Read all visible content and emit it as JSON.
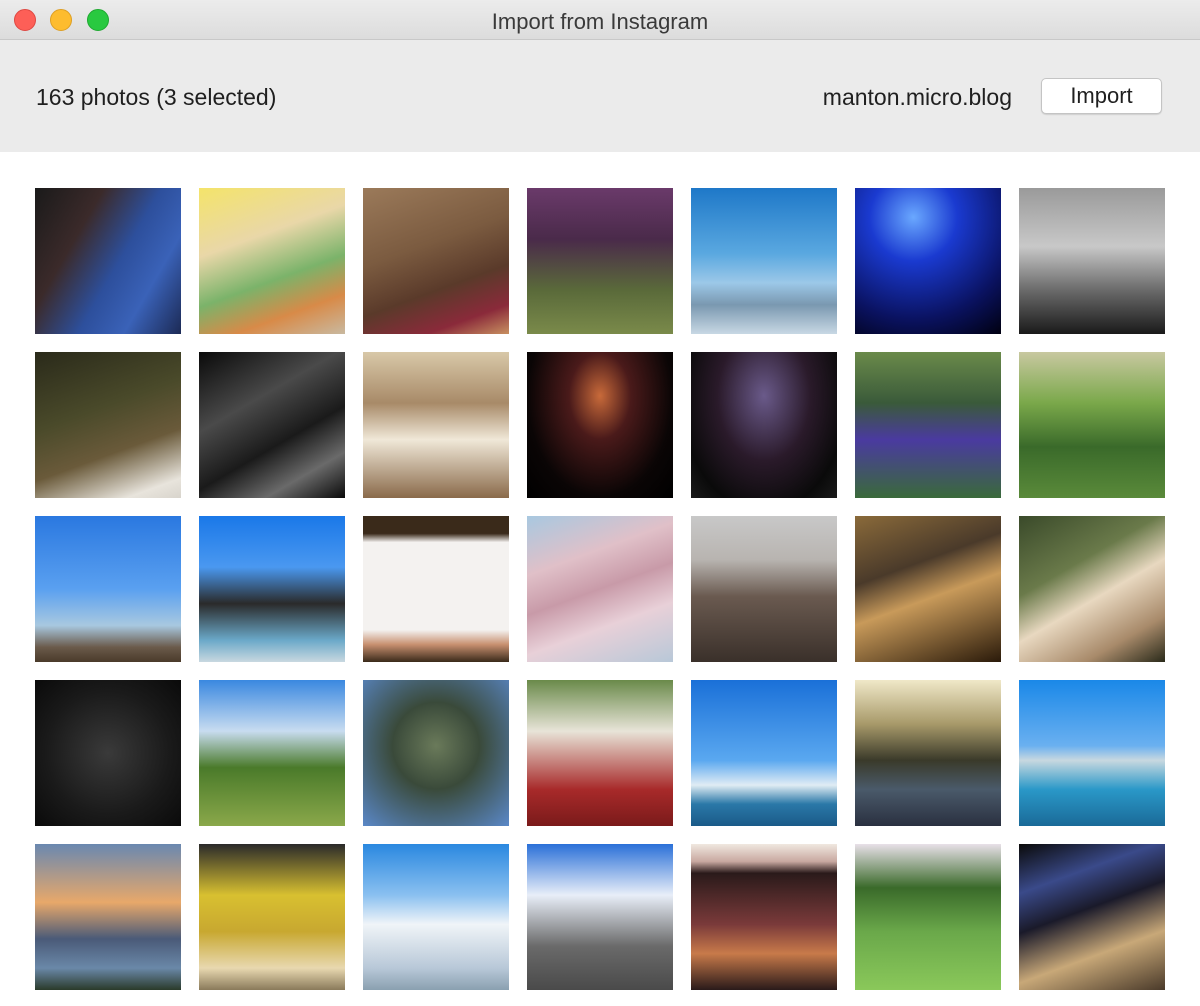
{
  "window": {
    "title": "Import from Instagram"
  },
  "toolbar": {
    "count_text": "163 photos (3 selected)",
    "account": "manton.micro.blog",
    "import_label": "Import"
  },
  "photos": [
    {
      "desc": "warriors-finals-shirt",
      "bg": "linear-gradient(120deg,#1a1a1a 0%,#3b2a2a 30%,#2d4f9c 55%,#3a62b8 75%,#1c2a55 100%)"
    },
    {
      "desc": "juice-bar",
      "bg": "linear-gradient(160deg,#f4e46a 0%,#e9d7a8 35%,#7bb36a 60%,#d88a48 80%,#c9b9a0 100%)"
    },
    {
      "desc": "chipotle-bag",
      "bg": "linear-gradient(160deg,#9b7a5a 0%,#7b5b40 40%,#5a3a2a 65%,#8a2a3a 85%,#c89060 100%)"
    },
    {
      "desc": "purple-trees",
      "bg": "linear-gradient(180deg,#6a3a6a 0%,#4a2a4a 35%,#5a6a3a 70%,#7a8a4a 100%)"
    },
    {
      "desc": "sky-mountains",
      "bg": "linear-gradient(180deg,#1e78c8 0%,#5aa8e0 45%,#9cc8e8 65%,#7a98b0 80%,#c8d8e4 100%)"
    },
    {
      "desc": "concert-blue",
      "bg": "radial-gradient(circle at 40% 20%,#6aa8ff 0%,#1a3ad0 30%,#0a1260 70%,#000010 100%)"
    },
    {
      "desc": "austin-bw",
      "bg": "linear-gradient(180deg,#9a9a9a 0%,#c8c8c8 40%,#6a6a6a 70%,#1a1a1a 100%)"
    },
    {
      "desc": "dog-trail",
      "bg": "linear-gradient(160deg,#2a2a1a 0%,#4a4a2a 40%,#6a5a3a 65%,#e8e4dc 90%,#d8d4cc 100%)"
    },
    {
      "desc": "bw-bar",
      "bg": "linear-gradient(150deg,#0a0a0a 0%,#4a4a4a 35%,#1a1a1a 60%,#6a6a6a 80%,#0a0a0a 100%)"
    },
    {
      "desc": "museum-interior",
      "bg": "linear-gradient(180deg,#d8c8a8 0%,#a88a68 35%,#f0e8d8 60%,#8a6a4a 100%)"
    },
    {
      "desc": "zilker-tree",
      "bg": "radial-gradient(ellipse at 50% 30%,#c86a3a 0%,#4a1a1a 30%,#0a0505 70%,#000 100%)"
    },
    {
      "desc": "arena-screen",
      "bg": "radial-gradient(ellipse at 50% 30%,#6a5a8a 0%,#2a1a2a 45%,#0a0a0a 80%,#1a1a1a 100%)"
    },
    {
      "desc": "christmas-tree",
      "bg": "linear-gradient(180deg,#6a8a4a 0%,#3a5a3a 35%,#4a3aa0 60%,#3a6a3a 100%)"
    },
    {
      "desc": "pine-field",
      "bg": "linear-gradient(180deg,#c8c8a0 0%,#7aa84a 35%,#3a6a2a 65%,#5a8a3a 100%)"
    },
    {
      "desc": "ut-tower",
      "bg": "linear-gradient(180deg,#2a78e0 0%,#5aa0f0 50%,#a8c8e0 75%,#6a5a4a 90%,#4a3a2a 100%)"
    },
    {
      "desc": "fountain",
      "bg": "linear-gradient(180deg,#1a78e8 0%,#4a98f0 35%,#2a2a2a 60%,#6aa8c8 85%,#c8d8e0 100%)"
    },
    {
      "desc": "love-trumps-hate",
      "bg": "linear-gradient(180deg,#3a2a1a 0%,#3a2a1a 12%,#f4f2f0 18%,#f4f2f0 78%,#c89070 88%,#3a2a1a 100%)"
    },
    {
      "desc": "pink-clouds",
      "bg": "linear-gradient(160deg,#a8c8e0 0%,#e0c0c8 30%,#c89aa8 50%,#e8d0d8 70%,#b8c8d8 100%)"
    },
    {
      "desc": "capitol",
      "bg": "linear-gradient(180deg,#c8c8c8 0%,#b8b4b0 30%,#6a5a50 55%,#3a302a 100%)"
    },
    {
      "desc": "library",
      "bg": "linear-gradient(160deg,#8a6a3a 0%,#4a3a2a 35%,#c89a5a 55%,#2a1a0a 100%)"
    },
    {
      "desc": "villa-arch",
      "bg": "linear-gradient(150deg,#3a4a2a 0%,#6a7a4a 35%,#e8d8c0 55%,#a88a6a 80%,#2a2a1a 100%)"
    },
    {
      "desc": "rubiks-cubes",
      "bg": "radial-gradient(circle at 50% 50%,#3a3a3a 0%,#1a1a1a 60%,#0a0a0a 100%)"
    },
    {
      "desc": "green-field",
      "bg": "linear-gradient(180deg,#3a88e0 0%,#c8dcf0 35%,#4a7a2a 60%,#8aa84a 100%)"
    },
    {
      "desc": "oak-canopy",
      "bg": "radial-gradient(circle at 50% 45%,#6a7a5a 0%,#3a4a3a 40%,#5a88c8 100%)"
    },
    {
      "desc": "terrys",
      "bg": "linear-gradient(180deg,#6a8a4a 0%,#e8e4d8 35%,#a82a2a 75%,#7a1a1a 100%)"
    },
    {
      "desc": "ocean-sky",
      "bg": "linear-gradient(180deg,#1a70d8 0%,#5aa8f0 55%,#e0ecf4 72%,#2a78a8 85%,#1a5a88 100%)"
    },
    {
      "desc": "river-sunset",
      "bg": "linear-gradient(180deg,#f0e8c8 0%,#a89a6a 30%,#3a3a2a 55%,#4a5a6a 75%,#2a3040 100%)"
    },
    {
      "desc": "infinity-pool",
      "bg": "linear-gradient(180deg,#1a88e8 0%,#6ab0f0 45%,#c8d8e0 55%,#2a98c8 75%,#1a6a98 100%)"
    },
    {
      "desc": "lake-sunset",
      "bg": "linear-gradient(180deg,#6a88b0 0%,#e8a86a 40%,#4a5a78 65%,#6a88a8 85%,#2a3a2a 100%)"
    },
    {
      "desc": "basketball-arena",
      "bg": "linear-gradient(180deg,#2a2a2a 0%,#d8c030 35%,#c8a830 60%,#e8d8b0 85%,#8a7a5a 100%)"
    },
    {
      "desc": "golden-gate",
      "bg": "linear-gradient(180deg,#2a88e0 0%,#8ac0f0 35%,#f0f4f8 55%,#b8c8d8 85%,#8aa0b0 100%)"
    },
    {
      "desc": "gothic-church",
      "bg": "linear-gradient(180deg,#2a70d8 0%,#e8eef8 35%,#6a6a6a 70%,#4a4a4a 100%)"
    },
    {
      "desc": "root-beer",
      "bg": "linear-gradient(180deg,#f0e8e0 0%,#c8a8a0 12%,#2a1a1a 20%,#7a3a3a 55%,#c87a4a 75%,#2a1a1a 100%)"
    },
    {
      "desc": "meadow-trees",
      "bg": "linear-gradient(180deg,#e8e0e8 0%,#3a6a2a 30%,#6aa84a 60%,#8ac85a 100%)"
    },
    {
      "desc": "spurs-arena",
      "bg": "linear-gradient(160deg,#0a0a0a 0%,#3a4a8a 25%,#1a1a2a 45%,#c8a878 70%,#4a3a2a 100%)"
    }
  ]
}
